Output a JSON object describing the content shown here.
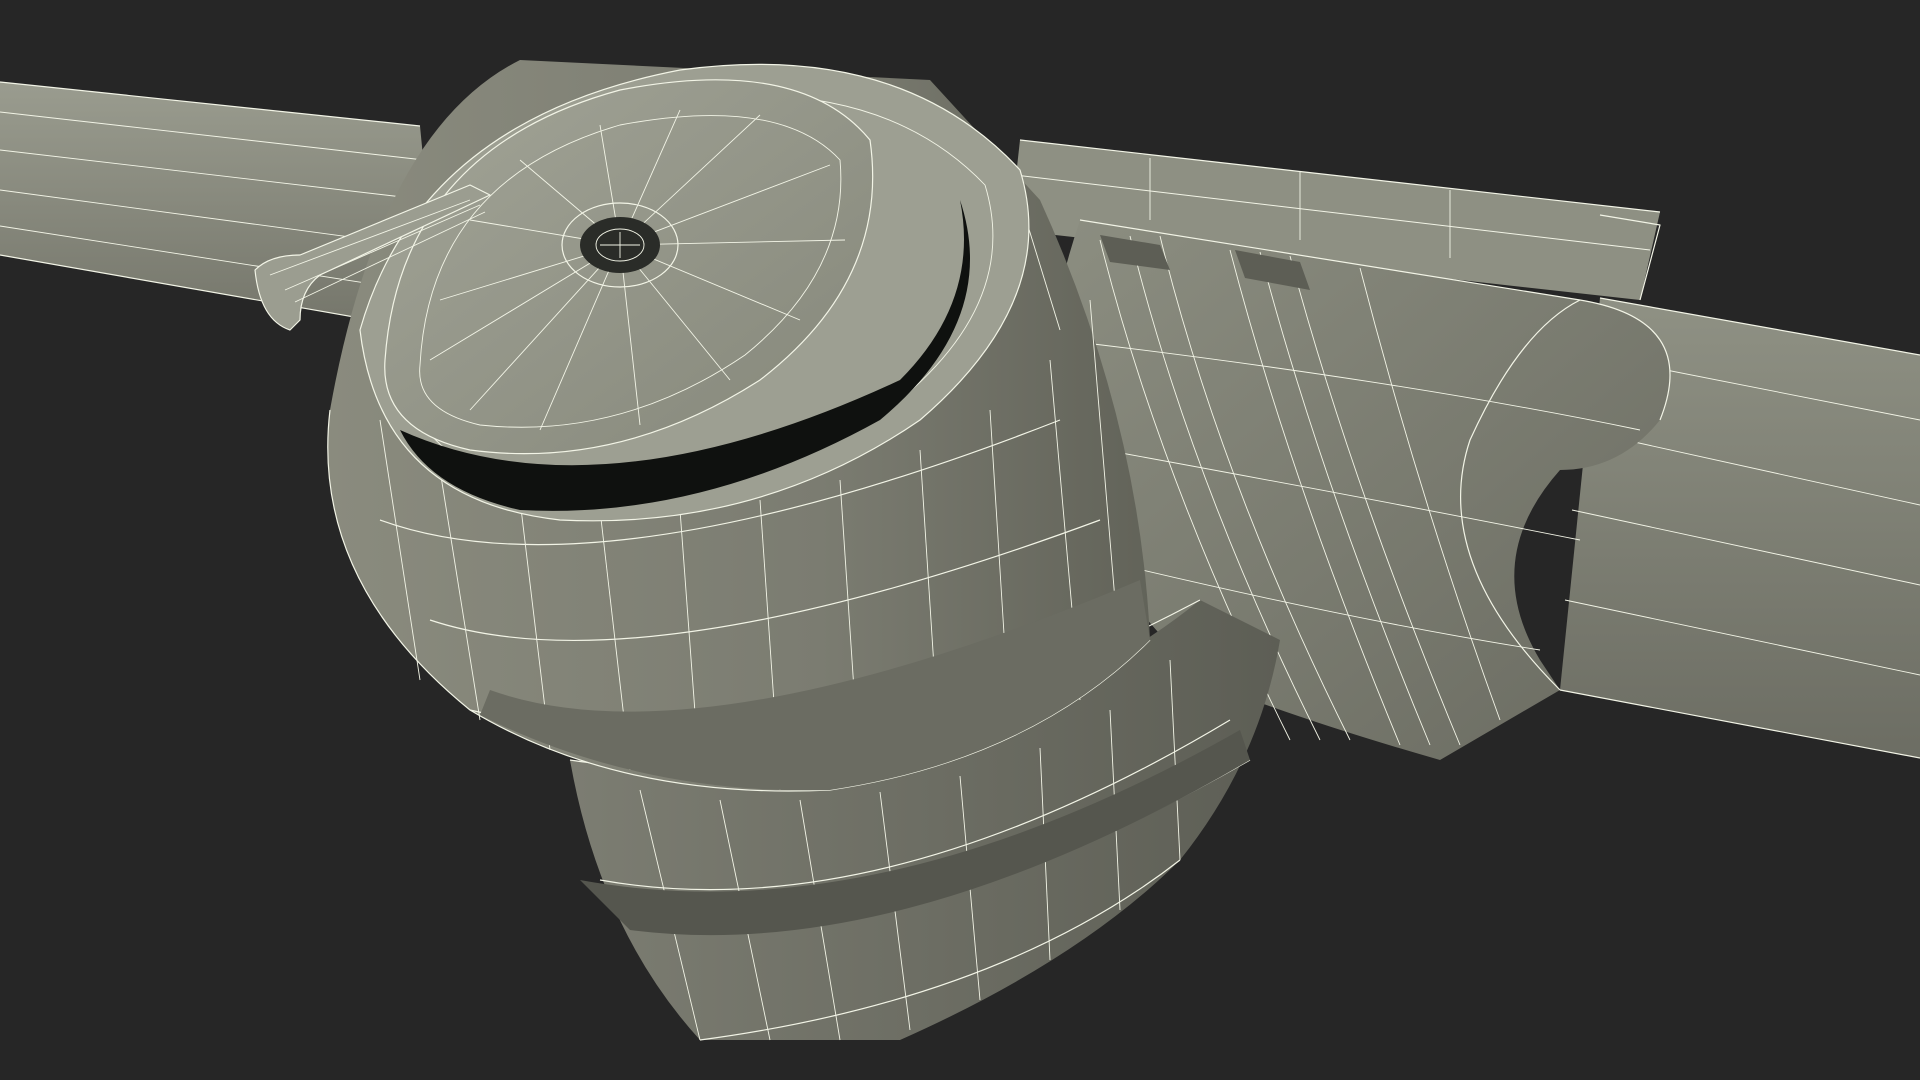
{
  "scene": {
    "background_color": "#262626",
    "mesh_color": "#8a8b7e",
    "mesh_shadow_color": "#5f6057",
    "mesh_highlight_color": "#9a9c8f",
    "wire_color": "#f2f4e6",
    "cavity_color": "#101210"
  }
}
